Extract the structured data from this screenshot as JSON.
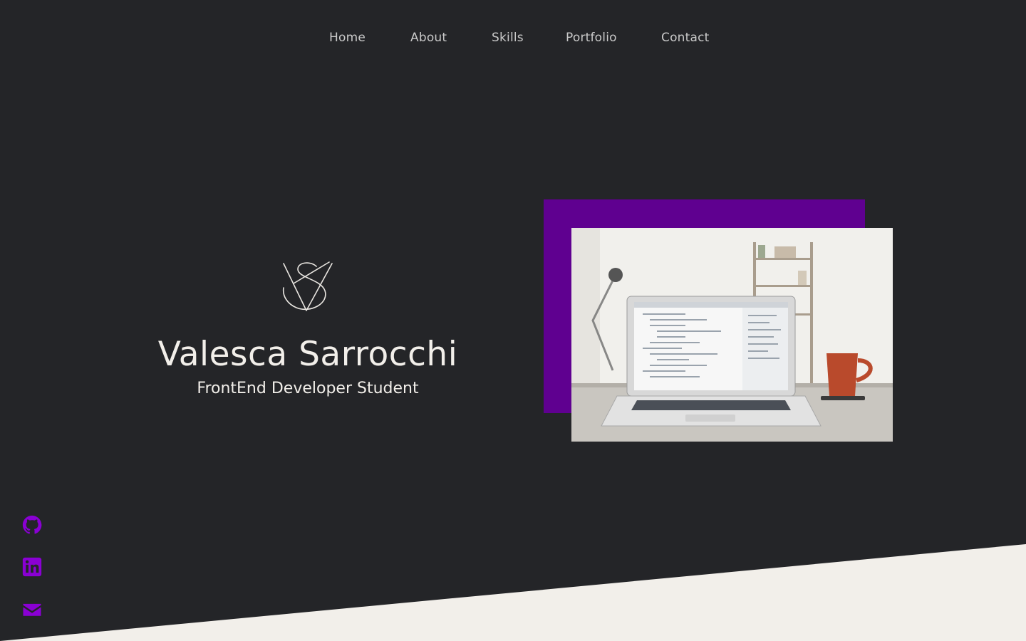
{
  "nav": {
    "items": [
      {
        "label": "Home"
      },
      {
        "label": "About"
      },
      {
        "label": "Skills"
      },
      {
        "label": "Portfolio"
      },
      {
        "label": "Contact"
      }
    ]
  },
  "hero": {
    "logo_icon": "vs-monogram-icon",
    "name": "Valesca Sarrocchi",
    "role": "FrontEnd Developer Student",
    "image_icon": "laptop-desk-photo"
  },
  "social": {
    "items": [
      {
        "icon": "github-icon"
      },
      {
        "icon": "linkedin-icon"
      },
      {
        "icon": "envelope-icon"
      }
    ]
  },
  "colors": {
    "background": "#242528",
    "accent": "#5f0090",
    "social_icon": "#8a00d4",
    "text": "#f2efea",
    "nav_text": "#c9c9c9",
    "footer_band": "#f2efea"
  }
}
